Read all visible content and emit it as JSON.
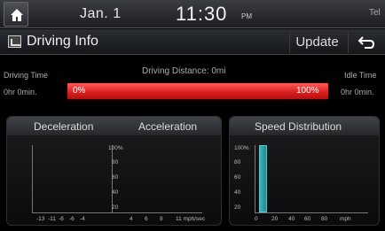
{
  "status_bar": {
    "date": "Jan. 1",
    "time": "11:30",
    "ampm": "PM",
    "signal": "Tel"
  },
  "title_bar": {
    "title": "Driving Info",
    "update_label": "Update"
  },
  "info": {
    "driving_time_label": "Driving Time",
    "driving_distance": "Driving Distance: 0mi",
    "idle_time_label": "Idle Time",
    "driving_time_value": "0hr 0min.",
    "idle_time_value": "0hr 0min.",
    "bar_start": "0%",
    "bar_end": "100%",
    "bar_fill_percent": 100
  },
  "panels": {
    "deceleration_label": "Deceleration",
    "acceleration_label": "Acceleration",
    "speed_distribution_label": "Speed Distribution"
  },
  "chart_data": [
    {
      "type": "bar",
      "title": "",
      "y_ticks": [
        "100%",
        "80",
        "60",
        "40",
        "20"
      ],
      "x_ticks": [
        "-13",
        "-11",
        "-8",
        "-6",
        "-4",
        "4",
        "6",
        "8",
        "11 mph/sec"
      ],
      "values": []
    },
    {
      "type": "bar",
      "title": "Speed Distribution",
      "y_ticks": [
        "100%",
        "80",
        "60",
        "40",
        "20"
      ],
      "x_ticks": [
        "0",
        "20",
        "40",
        "60",
        "80",
        "mph"
      ],
      "categories": [
        "0-10"
      ],
      "values": [
        100
      ]
    }
  ],
  "colors": {
    "accent_red": "#d81e1e",
    "bar_teal": "#2a9ea5"
  }
}
